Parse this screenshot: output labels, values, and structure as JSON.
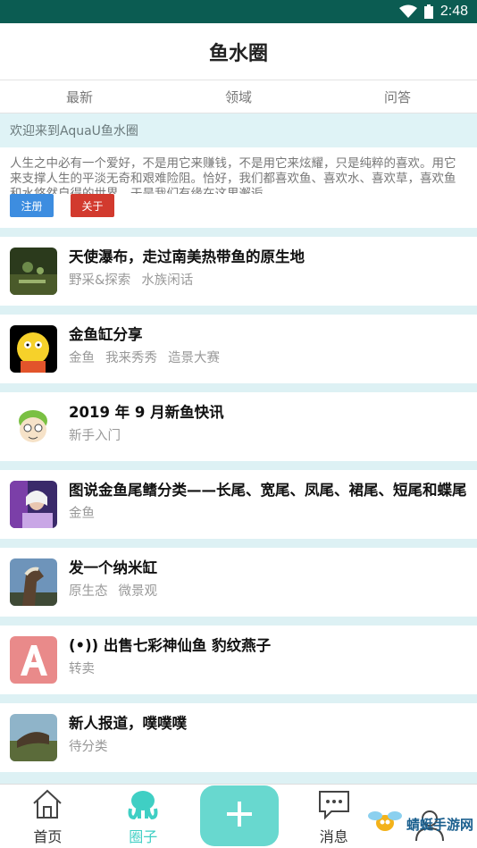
{
  "status": {
    "time": "2:48"
  },
  "header": {
    "title": "鱼水圈"
  },
  "tabs": [
    {
      "label": "最新"
    },
    {
      "label": "领域"
    },
    {
      "label": "问答"
    }
  ],
  "welcome": {
    "title": "欢迎来到AquaU鱼水圈",
    "text": "人生之中必有一个爱好，不是用它来赚钱，不是用它来炫耀，只是纯粹的喜欢。用它来支撑人生的平淡无奇和艰难险阻。恰好，我们都喜欢鱼、喜欢水、喜欢草，喜欢鱼和水悠然自得的世界，于是我们有缘在这里邂逅…",
    "register_label": "注册",
    "about_label": "关于"
  },
  "posts": [
    {
      "title": "天使瀑布，走过南美热带鱼的原生地",
      "tags": [
        "野采&探索",
        "水族闲话"
      ],
      "thumb": "waterfall"
    },
    {
      "title": "金鱼缸分享",
      "tags": [
        "金鱼",
        "我来秀秀",
        "造景大赛"
      ],
      "thumb": "cartoon"
    },
    {
      "title": "2019 年 9 月新鱼快讯",
      "tags": [
        "新手入门"
      ],
      "thumb": "melon"
    },
    {
      "title": "图说金鱼尾鳍分类——长尾、宽尾、凤尾、裙尾、短尾和蝶尾",
      "tags": [
        "金鱼"
      ],
      "thumb": "dj"
    },
    {
      "title": "发一个纳米缸",
      "tags": [
        "原生态",
        "微景观"
      ],
      "thumb": "horse"
    },
    {
      "title": "出售七彩神仙鱼 豹纹燕子",
      "tags": [
        "转卖"
      ],
      "thumb": "letter-a",
      "radio_icon": "(•))"
    },
    {
      "title": "新人报道，噗噗噗",
      "tags": [
        "待分类"
      ],
      "thumb": "dino"
    }
  ],
  "nav": {
    "home": "首页",
    "circle": "圈子",
    "messages": "消息",
    "profile": ""
  },
  "watermark": {
    "text": "蜻蜓手游网",
    "sub": "www.QT6.com"
  },
  "colors": {
    "statusbar": "#0b5c52",
    "accent": "#3fcfc4",
    "fab": "#68d8cf",
    "register": "#3d8de0",
    "about": "#d23a2e"
  }
}
